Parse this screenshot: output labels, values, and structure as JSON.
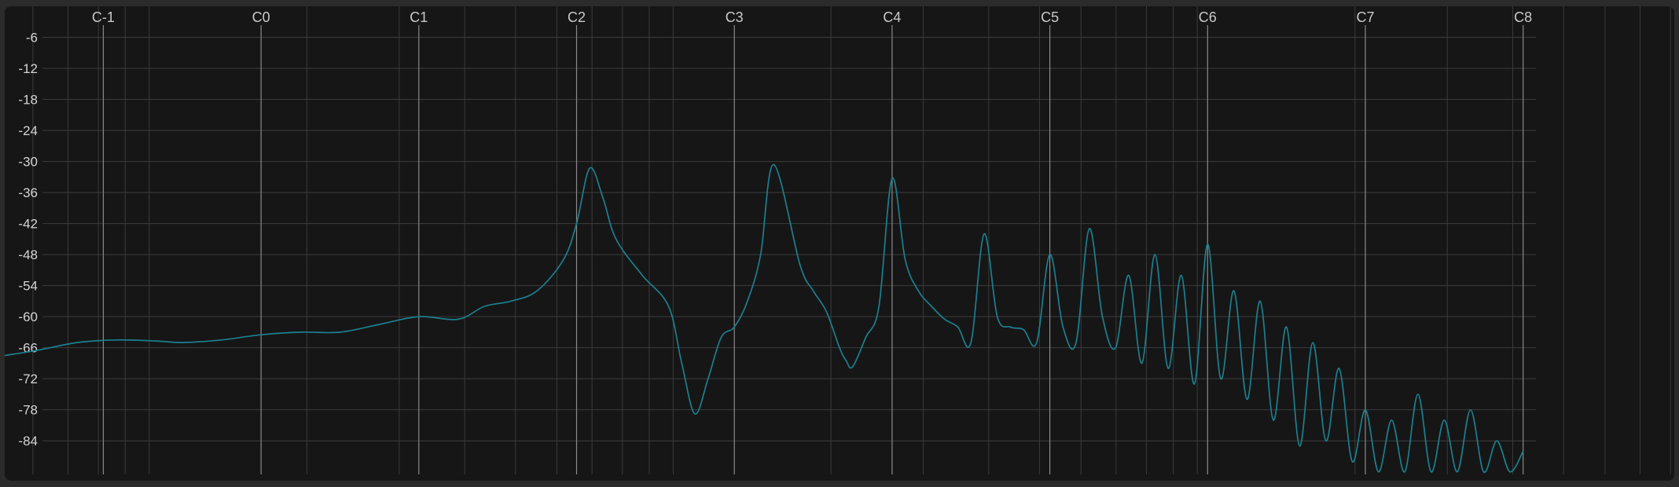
{
  "colors": {
    "background": "#161616",
    "grid_minor": "#3a3a3a",
    "grid_major": "#8a8a8a",
    "grid_horizontal": "#3c3c3c",
    "curve": "#1d7f8f",
    "tick_text": "#d4d4d4"
  },
  "chart_data": {
    "type": "line",
    "title": "",
    "xlabel": "",
    "ylabel": "",
    "x_scale": "log",
    "x_unit_tick_labels": "note names (C octaves)",
    "x_tick_labels": [
      "C-1",
      "C0",
      "C1",
      "C2",
      "C3",
      "C4",
      "C5",
      "C6",
      "C7",
      "C8"
    ],
    "x_tick_midi_notes": [
      0,
      12,
      24,
      36,
      48,
      60,
      72,
      84,
      96,
      108
    ],
    "xlim_midi": [
      -7.5,
      119.5
    ],
    "y_tick_labels": [
      "-6",
      "-12",
      "-18",
      "-24",
      "-30",
      "-36",
      "-42",
      "-48",
      "-54",
      "-60",
      "-66",
      "-72",
      "-78",
      "-84"
    ],
    "ylim": [
      -90.5,
      0
    ],
    "grid": true,
    "legend": "none",
    "series": [
      {
        "x_midi": [
          -7.5,
          -5,
          -2,
          1,
          4,
          6,
          9,
          12,
          15,
          18,
          21,
          24,
          27,
          29,
          31,
          33,
          35,
          36,
          37,
          38,
          39,
          41,
          43,
          44,
          45,
          46,
          47,
          48,
          49,
          50,
          51,
          53,
          54,
          55,
          56,
          56.5,
          57,
          58,
          59,
          60,
          61,
          62,
          63,
          64,
          65,
          66,
          67,
          68,
          69,
          70,
          71,
          72,
          73,
          74,
          75,
          76,
          77,
          78,
          79,
          80,
          81,
          82,
          83,
          84,
          85,
          86,
          87,
          88,
          89,
          90,
          91,
          92,
          93,
          94,
          95,
          96,
          97,
          98,
          99,
          100,
          101,
          102,
          103,
          104,
          105,
          106,
          107,
          108
        ],
        "y_db": [
          -67.5,
          -66.5,
          -65,
          -64.5,
          -64.7,
          -65,
          -64.5,
          -63.5,
          -63,
          -63,
          -61.5,
          -60,
          -60.5,
          -58,
          -57,
          -55,
          -49,
          -42,
          -31.3,
          -37,
          -45,
          -52,
          -58,
          -69,
          -78.8,
          -72,
          -64,
          -62,
          -57,
          -48,
          -30.6,
          -50,
          -55,
          -59,
          -66,
          -68.5,
          -69.7,
          -64,
          -58,
          -33.3,
          -49,
          -55,
          -58,
          -60.5,
          -62,
          -65,
          -44,
          -60,
          -62,
          -62.5,
          -65,
          -48,
          -62,
          -65,
          -43,
          -60,
          -66,
          -52,
          -69,
          -48,
          -70,
          -52,
          -73,
          -46,
          -72,
          -55,
          -76,
          -57,
          -80,
          -62,
          -85,
          -65,
          -84,
          -70,
          -88,
          -78,
          -90,
          -80,
          -90,
          -75,
          -90,
          -80,
          -90,
          -78,
          -90,
          -84,
          -90,
          -86
        ]
      }
    ]
  }
}
